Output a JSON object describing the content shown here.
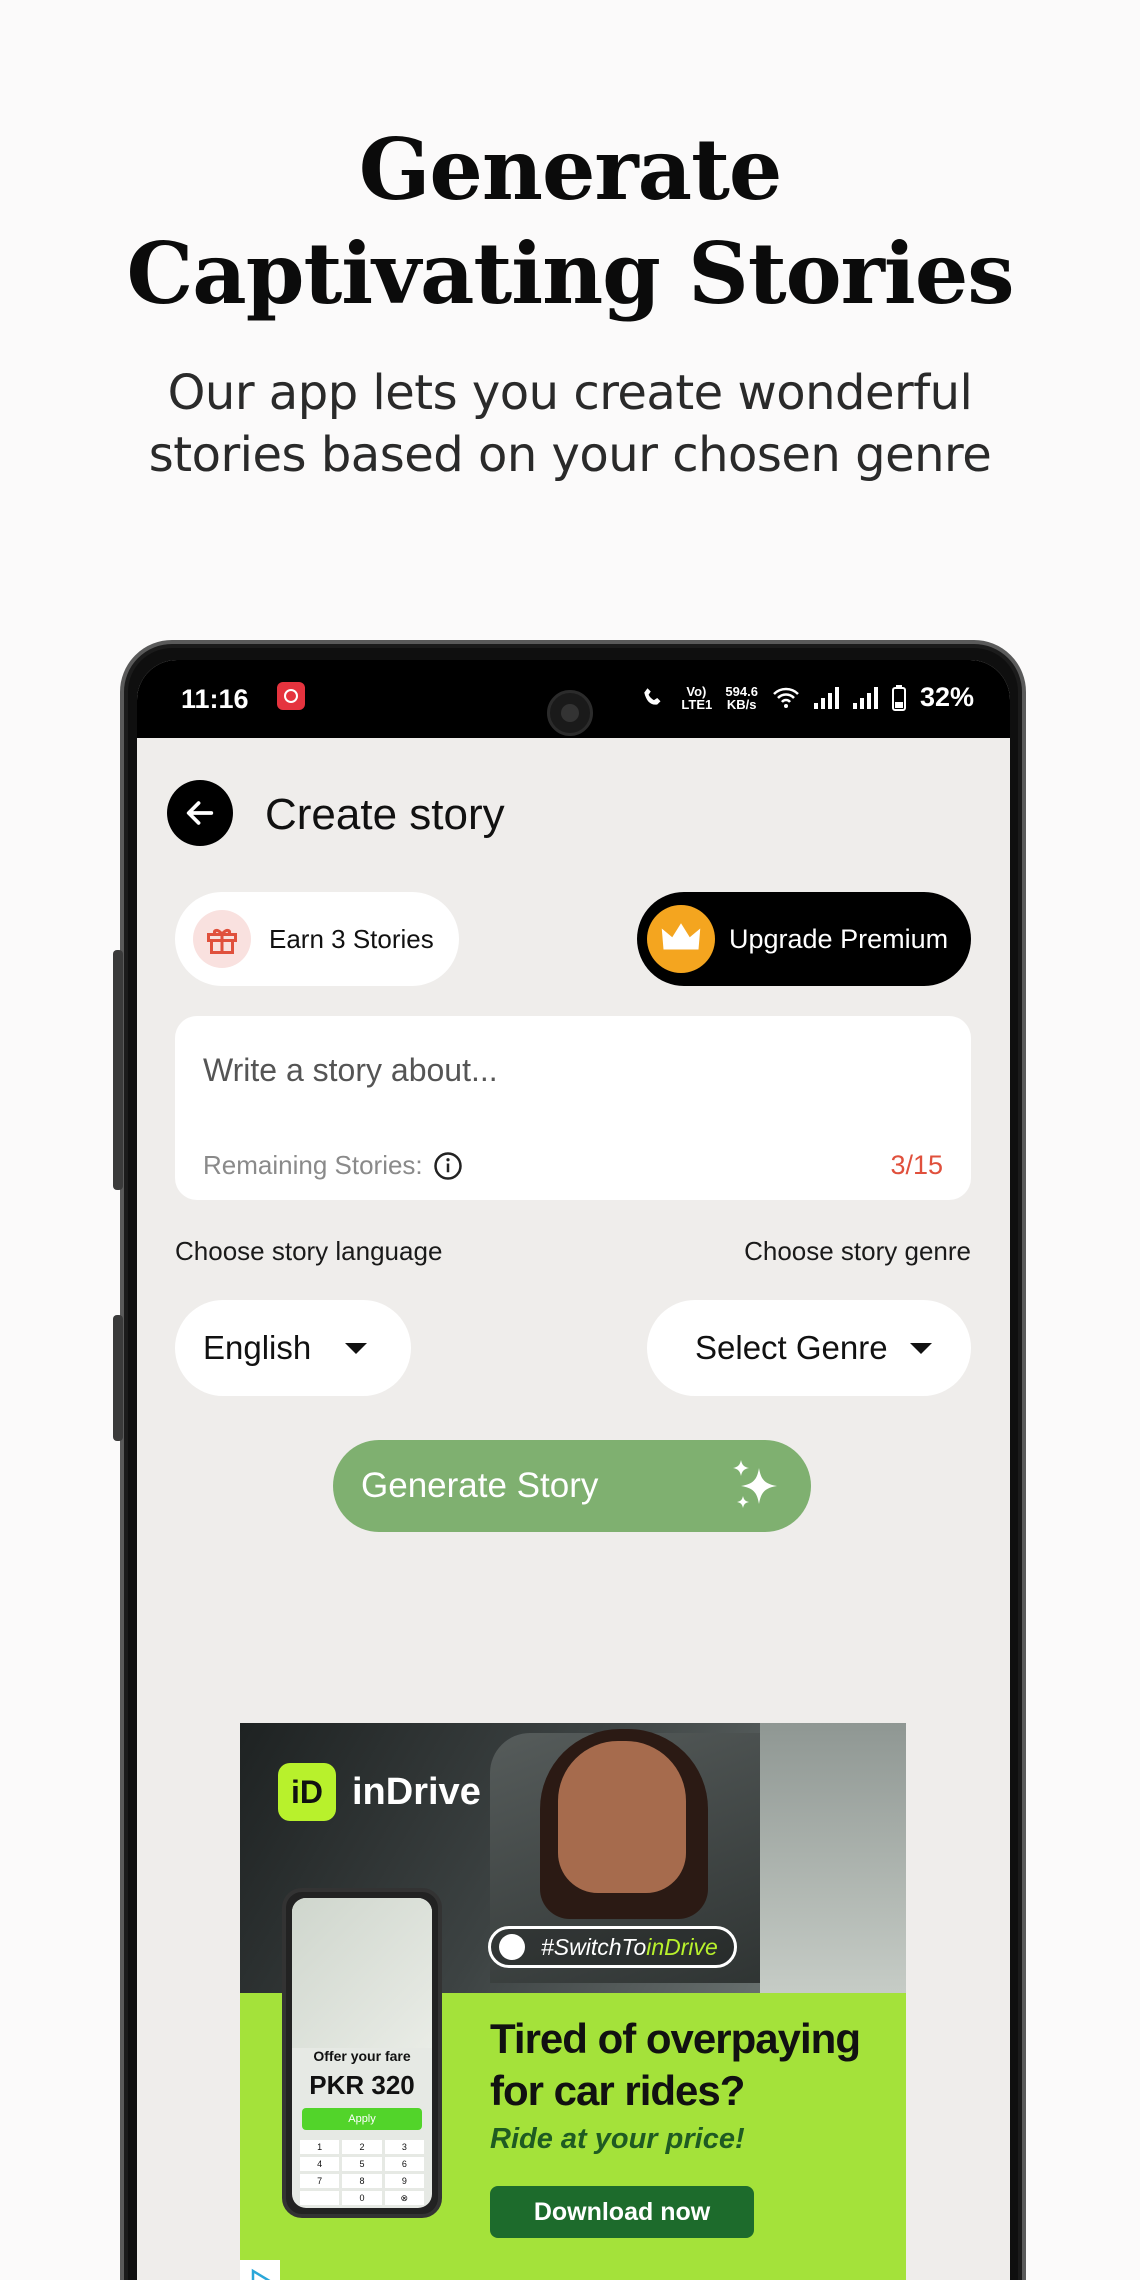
{
  "promo": {
    "headline_line1": "Generate",
    "headline_line2": "Captivating Stories",
    "subline_line1": "Our app lets you create wonderful",
    "subline_line2": "stories based on your chosen genre"
  },
  "status_bar": {
    "time": "11:16",
    "network_speed_value": "594.6",
    "network_speed_unit": "KB/s",
    "volte": "Vo) LTE1",
    "battery": "32%"
  },
  "screen": {
    "title": "Create story",
    "earn_label": "Earn 3 Stories",
    "premium_label": "Upgrade Premium",
    "story_placeholder": "Write a story about...",
    "remaining_label": "Remaining Stories:",
    "remaining_count": "3/15",
    "language_label": "Choose story language",
    "genre_label": "Choose story genre",
    "language_value": "English",
    "genre_value": "Select Genre",
    "generate_label": "Generate Story"
  },
  "ad": {
    "brand": "inDrive",
    "logo_text": "iD",
    "tag_prefix": "#SwitchTo",
    "tag_highlight": "inDrive",
    "phone_offer": "Offer your fare",
    "phone_price": "PKR 320",
    "phone_apply": "Apply",
    "phone_keys": [
      "1",
      "2",
      "3",
      "4",
      "5",
      "6",
      "7",
      "8",
      "9",
      "",
      "0",
      "⊗"
    ],
    "headline_line1": "Tired of overpaying",
    "headline_line2": "for car rides?",
    "subline": "Ride at your price!",
    "cta": "Download now"
  },
  "colors": {
    "generate_button": "#7fb070",
    "counter": "#e0503c",
    "ad_green": "#a4e23a",
    "crown": "#f4a51f"
  }
}
